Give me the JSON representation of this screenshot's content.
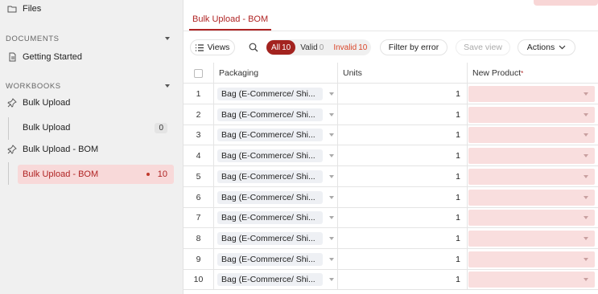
{
  "sidebar": {
    "files_label": "Files",
    "documents_section": "DOCUMENTS",
    "getting_started": "Getting Started",
    "workbooks_section": "WORKBOOKS",
    "workbooks": [
      {
        "label": "Bulk Upload",
        "sheets": [
          {
            "label": "Bulk Upload",
            "count": "0"
          }
        ]
      },
      {
        "label": "Bulk Upload - BOM",
        "sheets": [
          {
            "label": "Bulk Upload - BOM",
            "count": "10",
            "active": true
          }
        ]
      }
    ]
  },
  "main": {
    "tab_label": "Bulk Upload - BOM",
    "toolbar": {
      "views_label": "Views",
      "filter_all": "All",
      "filter_all_count": "10",
      "filter_valid": "Valid",
      "filter_valid_count": "0",
      "filter_invalid": "Invalid",
      "filter_invalid_count": "10",
      "filter_by_error": "Filter by error",
      "save_view": "Save view",
      "actions": "Actions"
    },
    "columns": [
      "Packaging",
      "Units",
      "New Product"
    ],
    "required_marker": "*",
    "rows": [
      {
        "num": "1",
        "packaging": "Bag (E-Commerce/ Shi...",
        "units": "1",
        "new_product": ""
      },
      {
        "num": "2",
        "packaging": "Bag (E-Commerce/ Shi...",
        "units": "1",
        "new_product": ""
      },
      {
        "num": "3",
        "packaging": "Bag (E-Commerce/ Shi...",
        "units": "1",
        "new_product": ""
      },
      {
        "num": "4",
        "packaging": "Bag (E-Commerce/ Shi...",
        "units": "1",
        "new_product": ""
      },
      {
        "num": "5",
        "packaging": "Bag (E-Commerce/ Shi...",
        "units": "1",
        "new_product": ""
      },
      {
        "num": "6",
        "packaging": "Bag (E-Commerce/ Shi...",
        "units": "1",
        "new_product": ""
      },
      {
        "num": "7",
        "packaging": "Bag (E-Commerce/ Shi...",
        "units": "1",
        "new_product": ""
      },
      {
        "num": "8",
        "packaging": "Bag (E-Commerce/ Shi...",
        "units": "1",
        "new_product": ""
      },
      {
        "num": "9",
        "packaging": "Bag (E-Commerce/ Shi...",
        "units": "1",
        "new_product": ""
      },
      {
        "num": "10",
        "packaging": "Bag (E-Commerce/ Shi...",
        "units": "1",
        "new_product": ""
      }
    ]
  },
  "colors": {
    "accent": "#a3231f",
    "invalid_cell": "#f9dede",
    "active_sidebar": "#f8d9d9",
    "sidebar_bg": "#f0f0f0"
  },
  "icons": {
    "files": "folder-icon",
    "document": "document-icon",
    "workbook": "pin-icon",
    "views": "list-icon",
    "search": "search-icon",
    "actions": "chevron-down-icon"
  }
}
